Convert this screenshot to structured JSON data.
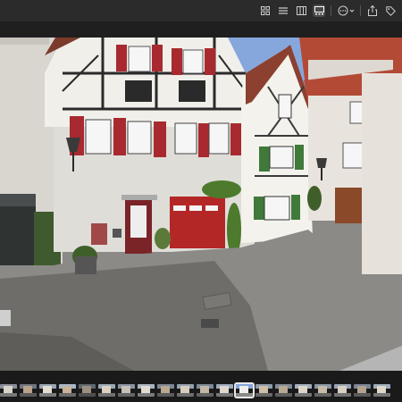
{
  "toolbar": {
    "buttons": [
      {
        "name": "grid-view-button",
        "icon": "grid-icon"
      },
      {
        "name": "list-view-button",
        "icon": "list-icon"
      },
      {
        "name": "column-view-button",
        "icon": "columns-icon"
      },
      {
        "name": "gallery-view-button",
        "icon": "gallery-icon",
        "active": true
      },
      {
        "name": "more-actions-button",
        "icon": "ellipsis-circle-icon"
      },
      {
        "name": "share-button",
        "icon": "share-icon"
      },
      {
        "name": "tag-button",
        "icon": "tag-icon"
      }
    ]
  },
  "photo": {
    "description_colors": {
      "sky": "#86a7dc",
      "half_timber_white": "#f1efe9",
      "shutter_red": "#a82a30",
      "shutter_green": "#3f7a3a",
      "garage_red": "#b42727",
      "roof_red": "#b34a36",
      "cobblestone": "#8b8a87"
    }
  },
  "filmstrip": {
    "thumbnails": [
      {
        "sky": "#8a8f9a",
        "wall": "#d8d4cc",
        "ground": "#777"
      },
      {
        "sky": "#6d7580",
        "wall": "#b9a28c",
        "ground": "#5a5a5a"
      },
      {
        "sky": "#99a4b3",
        "wall": "#e4ddd2",
        "ground": "#7c7c7c"
      },
      {
        "sky": "#a7b6c8",
        "wall": "#c9b29a",
        "ground": "#6b6b6b"
      },
      {
        "sky": "#5e6670",
        "wall": "#9c8f80",
        "ground": "#4f4f4f"
      },
      {
        "sky": "#9aa8b8",
        "wall": "#dcd2c4",
        "ground": "#707070"
      },
      {
        "sky": "#8894a4",
        "wall": "#c7c0b6",
        "ground": "#656565"
      },
      {
        "sky": "#a8b4c0",
        "wall": "#e2dcd2",
        "ground": "#7a7a7a"
      },
      {
        "sky": "#7c8796",
        "wall": "#b9a98f",
        "ground": "#5c5c5c"
      },
      {
        "sky": "#93a0ae",
        "wall": "#d6cdbf",
        "ground": "#6e6e6e"
      },
      {
        "sky": "#7d8998",
        "wall": "#c3b7a5",
        "ground": "#626262"
      },
      {
        "sky": "#9aa9bb",
        "wall": "#e0d8cd",
        "ground": "#767676"
      },
      {
        "sky": "#86a7dc",
        "wall": "#f1efe9",
        "ground": "#8b8a87",
        "selected": true
      },
      {
        "sky": "#8f9cab",
        "wall": "#cdbfaa",
        "ground": "#686868"
      },
      {
        "sky": "#7f8b99",
        "wall": "#b7a994",
        "ground": "#5e5e5e"
      },
      {
        "sky": "#a2afbe",
        "wall": "#ddd5c8",
        "ground": "#747474"
      },
      {
        "sky": "#8a96a5",
        "wall": "#c6bba9",
        "ground": "#646464"
      },
      {
        "sky": "#97a4b3",
        "wall": "#d9d0c3",
        "ground": "#717171"
      },
      {
        "sky": "#7a8594",
        "wall": "#b2a38e",
        "ground": "#5a5a5a"
      },
      {
        "sky": "#9eabba",
        "wall": "#dfd7ca",
        "ground": "#757575"
      }
    ]
  }
}
